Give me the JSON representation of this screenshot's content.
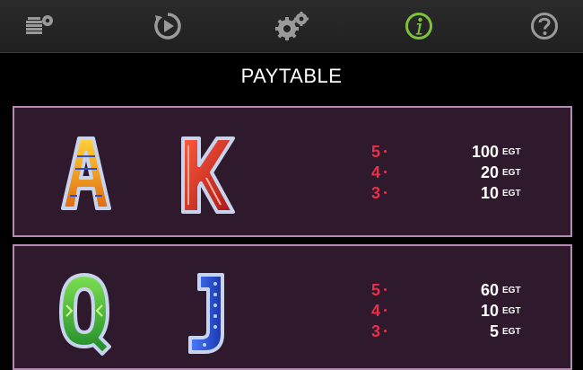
{
  "toolbar": {
    "buttons": [
      {
        "icon": "bet-settings-icon"
      },
      {
        "icon": "autoplay-icon"
      },
      {
        "icon": "settings-icon"
      },
      {
        "icon": "info-icon",
        "active": true
      },
      {
        "icon": "help-icon"
      }
    ],
    "active_color": "#7ec23a",
    "icon_color": "#9a9a9a"
  },
  "page": {
    "title": "PAYTABLE"
  },
  "groups": [
    {
      "symbols": [
        {
          "letter": "A",
          "name": "symbol-a",
          "color": "#f0a020"
        },
        {
          "letter": "K",
          "name": "symbol-k",
          "color": "#d02a2a"
        }
      ],
      "pays": [
        {
          "count": "5",
          "amount": "100",
          "unit": "EGT"
        },
        {
          "count": "4",
          "amount": "20",
          "unit": "EGT"
        },
        {
          "count": "3",
          "amount": "10",
          "unit": "EGT"
        }
      ]
    },
    {
      "symbols": [
        {
          "letter": "Q",
          "name": "symbol-q",
          "color": "#3cb83c"
        },
        {
          "letter": "J",
          "name": "symbol-j",
          "color": "#2a58d8"
        }
      ],
      "pays": [
        {
          "count": "5",
          "amount": "60",
          "unit": "EGT"
        },
        {
          "count": "4",
          "amount": "10",
          "unit": "EGT"
        },
        {
          "count": "3",
          "amount": "5",
          "unit": "EGT"
        }
      ]
    }
  ]
}
